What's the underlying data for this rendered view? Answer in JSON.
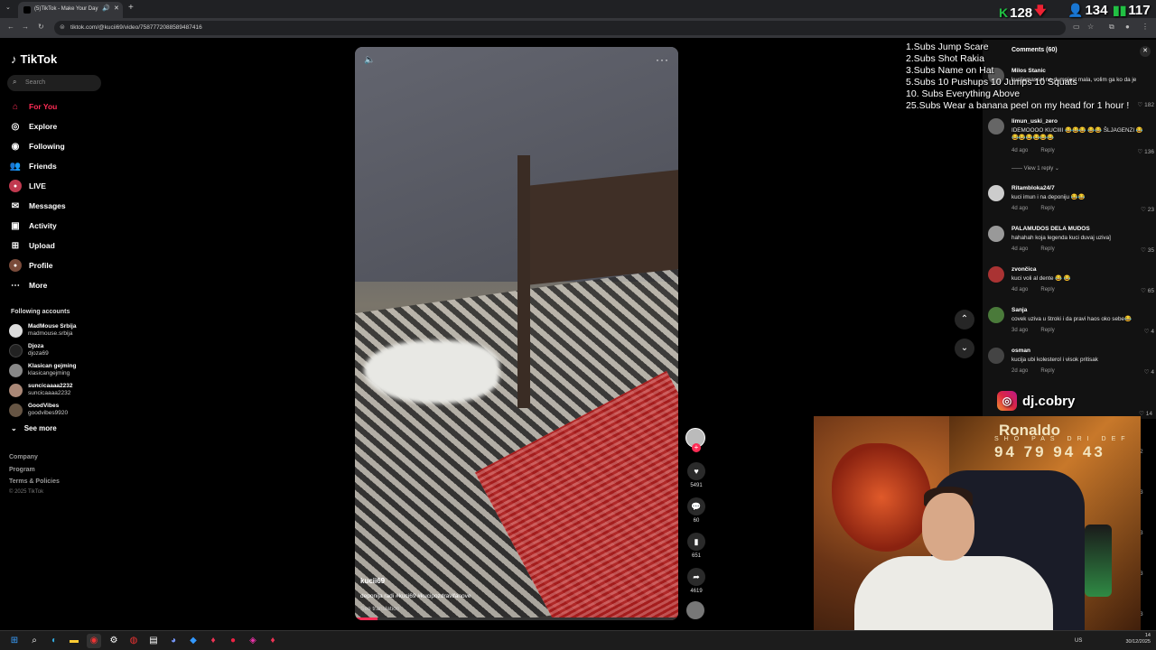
{
  "browser": {
    "tab_title": "(5)TikTok - Make Your Day",
    "url": "tiktok.com/@kucii69/video/7587772088589487416"
  },
  "stream_stats": [
    {
      "icon": "kick-icon",
      "value": "128"
    },
    {
      "icon": "person-icon",
      "value": "134"
    },
    {
      "icon": "bars-icon",
      "value": "117"
    }
  ],
  "sidebar": {
    "logo": "TikTok",
    "search_placeholder": "Search",
    "nav": [
      {
        "label": "For You",
        "icon": "home-icon",
        "active": true
      },
      {
        "label": "Explore",
        "icon": "compass-icon"
      },
      {
        "label": "Following",
        "icon": "following-icon"
      },
      {
        "label": "Friends",
        "icon": "friends-icon"
      },
      {
        "label": "LIVE",
        "icon": "live-icon"
      },
      {
        "label": "Messages",
        "icon": "messages-icon"
      },
      {
        "label": "Activity",
        "icon": "activity-icon"
      },
      {
        "label": "Upload",
        "icon": "upload-icon"
      },
      {
        "label": "Profile",
        "icon": "profile-icon"
      },
      {
        "label": "More",
        "icon": "more-icon"
      }
    ],
    "following_header": "Following accounts",
    "accounts": [
      {
        "name": "MadMouse Srbija",
        "handle": "madmouse.srbija"
      },
      {
        "name": "Djoza",
        "handle": "djoza69"
      },
      {
        "name": "Klasican gejming",
        "handle": "klasicangejming"
      },
      {
        "name": "suncicaaaa2232",
        "handle": "suncicaaaa2232"
      },
      {
        "name": "GoodVibes",
        "handle": "goodvibes9920"
      }
    ],
    "see_more": "See more",
    "footer": [
      "Company",
      "Program",
      "Terms & Policies"
    ],
    "copyright": "© 2025 TikTok"
  },
  "video": {
    "author": "kucii69",
    "caption": "deponija radi #kuci69 #kucipozdravifanove",
    "translate": "See translation",
    "progress": 0.07
  },
  "actions": {
    "likes": "5491",
    "comments": "60",
    "saves": "651",
    "shares": "4619"
  },
  "comments": {
    "header": "Comments (60)",
    "items": [
      {
        "user": "Milos Stanic",
        "text": "kucijemassal na dumpjest mala, volim ga ko da je",
        "age": "",
        "likes": "182"
      },
      {
        "user": "limun_uski_zero",
        "text": "IDEMOOOO KUCIIII 😂😂😂 😂😂 ŠLJAGENZI 😂😂😂😂😂😂😂",
        "age": "4d ago",
        "likes": "136"
      },
      {
        "user": "Ritambloka24/7",
        "text": "kuci imun i na deponiju 😂😂",
        "age": "4d ago",
        "likes": "23"
      },
      {
        "user": "PALAMUDOS DELA MUDOS",
        "text": "hahahah koja legenda kuci duvaj uziva]",
        "age": "4d ago",
        "likes": "35"
      },
      {
        "user": "zvončica",
        "text": "kuci voli al dente 😂 😂",
        "age": "4d ago",
        "likes": "65"
      },
      {
        "user": "Sanja",
        "text": "covek uziva u štroki i da pravi haos oko sebe😂",
        "age": "3d ago",
        "likes": "4"
      },
      {
        "user": "osman",
        "text": "kucija ubi kolesterol i visok pritisak",
        "age": "2d ago",
        "likes": "4"
      }
    ],
    "reply_label": "Reply",
    "view_replies": "View 1 reply",
    "extra_likes": [
      "14",
      "2",
      "3",
      "3",
      "3",
      "3"
    ]
  },
  "goals": [
    "1.Subs Jump Scare",
    "2.Subs Shot Rakia",
    "3.Subs Name on Hat",
    "5.Subs 10 Pushups 10 Jumps 10 Squats",
    "10. Subs Everything Above",
    "25.Subs Wear a banana peel on my head for 1 hour !"
  ],
  "webcam": {
    "instagram": "dj.cobry",
    "poster_name": "Ronaldo",
    "poster_labels": "SHO PAS DRI DEF",
    "poster_values": "94 79 94 43"
  },
  "taskbar": {
    "lang": "US",
    "time": "14",
    "date": "30/12/2025"
  }
}
